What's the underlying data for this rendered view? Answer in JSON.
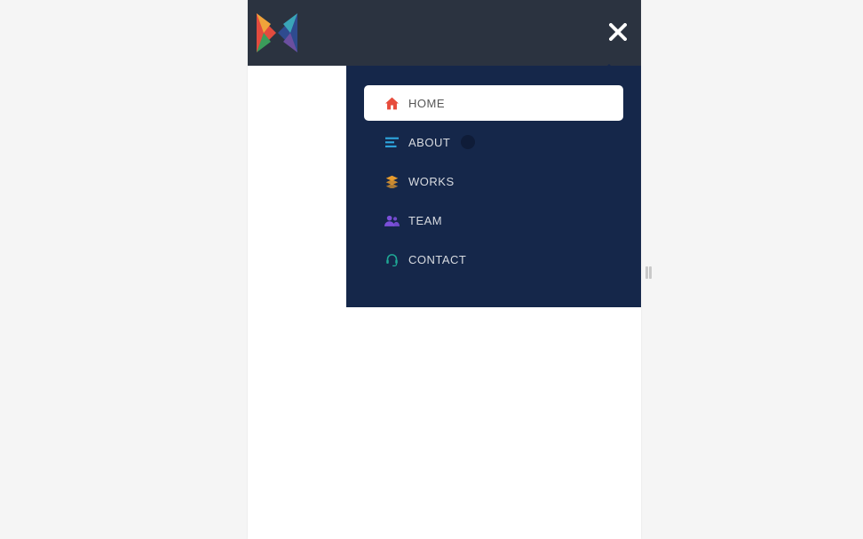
{
  "nav": {
    "items": [
      {
        "label": "HOME"
      },
      {
        "label": "ABOUT"
      },
      {
        "label": "WORKS"
      },
      {
        "label": "TEAM"
      },
      {
        "label": "CONTACT"
      }
    ]
  },
  "colors": {
    "header_bg": "#2b3340",
    "panel_bg": "#15274a",
    "active_bg": "#ffffff",
    "icon_red": "#e74c3c",
    "icon_blue": "#2ea7e0",
    "icon_orange": "#e79b2d",
    "icon_purple": "#7b4fd9",
    "icon_teal": "#1fa895"
  }
}
